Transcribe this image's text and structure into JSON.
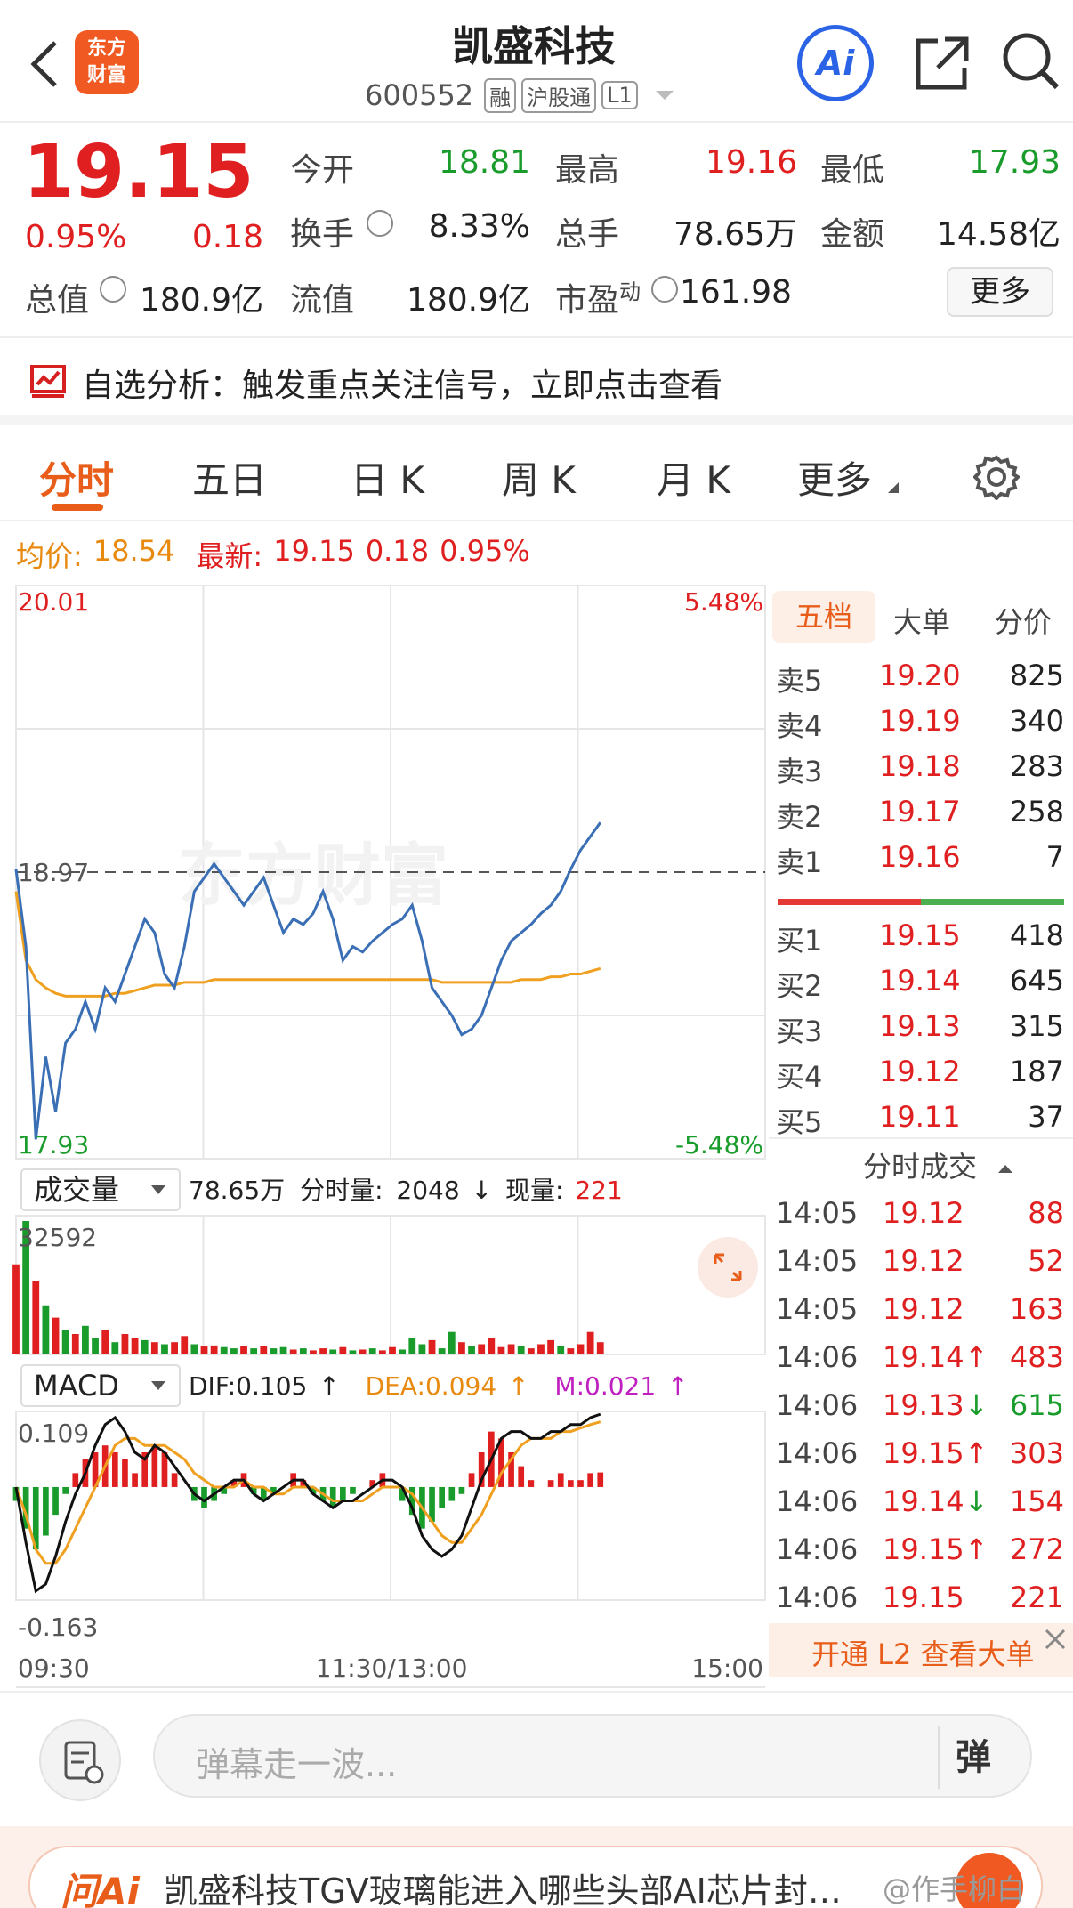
{
  "header": {
    "stock_name": "凯盛科技",
    "stock_code": "600552",
    "badges": [
      "融",
      "沪股通",
      "L1"
    ],
    "logo_text_top": "东方",
    "logo_text_bottom": "财富",
    "ai_label": "Ai"
  },
  "quote": {
    "price": "19.15",
    "change_pct": "0.95%",
    "change": "0.18",
    "rows": [
      [
        {
          "label": "今开",
          "value": "18.81",
          "color": "green"
        },
        {
          "label": "最高",
          "value": "19.16",
          "color": "red"
        },
        {
          "label": "最低",
          "value": "17.93",
          "color": "green"
        }
      ],
      [
        {
          "label": "换手",
          "value": "8.33%",
          "color": "dark"
        },
        {
          "label": "总手",
          "value": "78.65万",
          "color": "dark"
        },
        {
          "label": "金额",
          "value": "14.58亿",
          "color": "dark"
        }
      ],
      [
        {
          "label": "流值",
          "value": "180.9亿",
          "color": "dark"
        },
        {
          "label": "市盈",
          "sup": "动",
          "value": "161.98",
          "color": "dark"
        }
      ]
    ],
    "total_value_label": "总值",
    "total_value": "180.9亿",
    "more_button": "更多"
  },
  "analysis_banner": "自选分析：触发重点关注信号，立即点击查看",
  "tabs": [
    "分时",
    "五日",
    "日 K",
    "周 K",
    "月 K",
    "更多"
  ],
  "active_tab": 0,
  "summary": {
    "avg_label": "均价:",
    "avg_value": "18.54",
    "latest_label": "最新:",
    "latest_value": "19.15",
    "latest_change": "0.18",
    "latest_pct": "0.95%"
  },
  "chart_data": [
    {
      "type": "line",
      "name_price": "分时",
      "y_top_label": "20.01",
      "y_bottom_label": "17.93",
      "y_mid_label": "18.97",
      "pct_top_label": "5.48%",
      "pct_bottom_label": "-5.48%",
      "ylim": [
        17.93,
        20.01
      ],
      "prev_close": 18.97,
      "price_series": [
        18.98,
        18.7,
        18.0,
        18.3,
        18.1,
        18.35,
        18.4,
        18.5,
        18.4,
        18.55,
        18.5,
        18.6,
        18.7,
        18.8,
        18.75,
        18.6,
        18.55,
        18.7,
        18.9,
        18.95,
        19.0,
        18.95,
        18.9,
        18.85,
        18.9,
        18.95,
        18.85,
        18.75,
        18.8,
        18.78,
        18.82,
        18.9,
        18.8,
        18.65,
        18.7,
        18.68,
        18.72,
        18.75,
        18.78,
        18.8,
        18.85,
        18.72,
        18.55,
        18.5,
        18.45,
        18.38,
        18.4,
        18.45,
        18.55,
        18.65,
        18.72,
        18.75,
        18.78,
        18.82,
        18.85,
        18.9,
        18.98,
        19.05,
        19.1,
        19.15
      ],
      "avg_series": [
        18.9,
        18.65,
        18.58,
        18.55,
        18.53,
        18.52,
        18.52,
        18.52,
        18.52,
        18.52,
        18.53,
        18.53,
        18.54,
        18.55,
        18.56,
        18.56,
        18.56,
        18.57,
        18.57,
        18.57,
        18.58,
        18.58,
        18.58,
        18.58,
        18.58,
        18.58,
        18.58,
        18.58,
        18.58,
        18.58,
        18.58,
        18.58,
        18.58,
        18.58,
        18.58,
        18.58,
        18.58,
        18.58,
        18.58,
        18.58,
        18.58,
        18.58,
        18.58,
        18.57,
        18.57,
        18.57,
        18.57,
        18.57,
        18.57,
        18.57,
        18.57,
        18.58,
        18.58,
        18.58,
        18.59,
        18.59,
        18.6,
        18.6,
        18.61,
        18.62
      ],
      "x_labels": [
        "09:30",
        "11:30/13:00",
        "15:00"
      ]
    },
    {
      "type": "bar",
      "name": "成交量",
      "total": "78.65万",
      "tick_volume_label": "分时量:",
      "tick_volume": "2048",
      "now_volume_label": "现量:",
      "now_volume": "221",
      "y_max_label": "32592",
      "ylim": [
        0,
        32592
      ],
      "volumes": [
        22000,
        32592,
        18000,
        12000,
        9000,
        6000,
        5000,
        7000,
        4000,
        6000,
        3000,
        5000,
        4000,
        3500,
        3000,
        2500,
        3000,
        4500,
        2500,
        2000,
        2200,
        1800,
        1500,
        2000,
        1500,
        2000,
        1500,
        1800,
        1200,
        1500,
        1000,
        1500,
        1200,
        1800,
        1000,
        1200,
        1500,
        1000,
        1800,
        1200,
        4000,
        2500,
        3500,
        1500,
        5500,
        3000,
        2000,
        2500,
        4000,
        1800,
        2500,
        2000,
        1500,
        2500,
        3500,
        2000,
        1500,
        2500,
        5500,
        3000
      ],
      "up": [
        true,
        false,
        true,
        false,
        true,
        false,
        true,
        false,
        false,
        true,
        false,
        true,
        true,
        false,
        true,
        false,
        true,
        true,
        false,
        true,
        true,
        false,
        false,
        true,
        false,
        true,
        false,
        false,
        true,
        false,
        true,
        true,
        false,
        true,
        false,
        true,
        false,
        true,
        true,
        false,
        false,
        false,
        true,
        false,
        false,
        true,
        false,
        true,
        true,
        true,
        true,
        false,
        true,
        true,
        true,
        false,
        true,
        true,
        true,
        true
      ]
    },
    {
      "type": "bar",
      "name": "MACD",
      "dif_label": "DIF:0.105",
      "dea_label": "DEA:0.094",
      "m_label": "M:0.021",
      "y_top_label": "0.109",
      "y_bottom_label": "-0.163",
      "ylim": [
        -0.163,
        0.109
      ],
      "hist": [
        -0.02,
        -0.06,
        -0.09,
        -0.07,
        -0.04,
        -0.01,
        0.02,
        0.04,
        0.05,
        0.06,
        0.05,
        0.04,
        0.02,
        0.05,
        0.06,
        0.05,
        0.02,
        0.0,
        -0.02,
        -0.03,
        -0.02,
        -0.01,
        0.01,
        0.02,
        -0.01,
        -0.02,
        -0.01,
        0.0,
        0.02,
        0.01,
        -0.01,
        -0.02,
        -0.03,
        -0.02,
        -0.01,
        0.0,
        0.01,
        0.02,
        0.0,
        -0.02,
        -0.04,
        -0.06,
        -0.05,
        -0.03,
        -0.02,
        -0.01,
        0.02,
        0.05,
        0.08,
        0.07,
        0.05,
        0.03,
        0.01,
        0.0,
        0.01,
        0.02,
        0.01,
        0.01,
        0.02,
        0.021
      ],
      "dif": [
        0.0,
        -0.08,
        -0.15,
        -0.14,
        -0.1,
        -0.05,
        -0.01,
        0.02,
        0.06,
        0.09,
        0.1,
        0.08,
        0.05,
        0.04,
        0.06,
        0.05,
        0.03,
        0.01,
        -0.01,
        -0.02,
        -0.01,
        0.0,
        0.01,
        0.01,
        -0.01,
        -0.02,
        -0.01,
        0.0,
        0.01,
        0.01,
        -0.01,
        -0.02,
        -0.03,
        -0.02,
        -0.02,
        -0.01,
        0.0,
        0.01,
        0.01,
        0.0,
        -0.03,
        -0.07,
        -0.09,
        -0.1,
        -0.09,
        -0.07,
        -0.03,
        0.01,
        0.04,
        0.07,
        0.08,
        0.08,
        0.07,
        0.07,
        0.08,
        0.08,
        0.09,
        0.09,
        0.1,
        0.105
      ],
      "dea": [
        0.0,
        -0.04,
        -0.09,
        -0.11,
        -0.11,
        -0.09,
        -0.06,
        -0.03,
        0.0,
        0.03,
        0.06,
        0.07,
        0.07,
        0.06,
        0.06,
        0.06,
        0.05,
        0.04,
        0.02,
        0.01,
        0.0,
        0.0,
        0.0,
        0.01,
        0.0,
        0.0,
        -0.01,
        -0.01,
        0.0,
        0.0,
        0.0,
        -0.01,
        -0.02,
        -0.02,
        -0.02,
        -0.02,
        -0.01,
        0.0,
        0.0,
        0.0,
        -0.01,
        -0.03,
        -0.05,
        -0.07,
        -0.08,
        -0.08,
        -0.06,
        -0.04,
        -0.01,
        0.02,
        0.04,
        0.06,
        0.07,
        0.07,
        0.07,
        0.08,
        0.08,
        0.085,
        0.09,
        0.094
      ]
    }
  ],
  "orderbook": {
    "tabs": [
      "五档",
      "大单",
      "分价"
    ],
    "asks": [
      {
        "label": "卖5",
        "price": "19.20",
        "vol": "825"
      },
      {
        "label": "卖4",
        "price": "19.19",
        "vol": "340"
      },
      {
        "label": "卖3",
        "price": "19.18",
        "vol": "283"
      },
      {
        "label": "卖2",
        "price": "19.17",
        "vol": "258"
      },
      {
        "label": "卖1",
        "price": "19.16",
        "vol": "7"
      }
    ],
    "bids": [
      {
        "label": "买1",
        "price": "19.15",
        "vol": "418"
      },
      {
        "label": "买2",
        "price": "19.14",
        "vol": "645"
      },
      {
        "label": "买3",
        "price": "19.13",
        "vol": "315"
      },
      {
        "label": "买4",
        "price": "19.12",
        "vol": "187"
      },
      {
        "label": "买5",
        "price": "19.11",
        "vol": "37"
      }
    ],
    "ask_ratio": 0.5
  },
  "trades": {
    "title": "分时成交",
    "rows": [
      {
        "time": "14:05",
        "price": "19.12",
        "dir": "",
        "vol": "88",
        "color": "red"
      },
      {
        "time": "14:05",
        "price": "19.12",
        "dir": "",
        "vol": "52",
        "color": "red"
      },
      {
        "time": "14:05",
        "price": "19.12",
        "dir": "",
        "vol": "163",
        "color": "red"
      },
      {
        "time": "14:06",
        "price": "19.14",
        "dir": "↑",
        "vol": "483",
        "color": "red"
      },
      {
        "time": "14:06",
        "price": "19.13",
        "dir": "↓",
        "vol": "615",
        "color": "green"
      },
      {
        "time": "14:06",
        "price": "19.15",
        "dir": "↑",
        "vol": "303",
        "color": "red"
      },
      {
        "time": "14:06",
        "price": "19.14",
        "dir": "↓",
        "vol": "154",
        "color": "red"
      },
      {
        "time": "14:06",
        "price": "19.15",
        "dir": "↑",
        "vol": "272",
        "color": "red"
      },
      {
        "time": "14:06",
        "price": "19.15",
        "dir": "",
        "vol": "221",
        "color": "red"
      }
    ],
    "l2_banner": "开通 L2 查看大单"
  },
  "comment": {
    "placeholder": "弹幕走一波...",
    "danmu_button": "弹"
  },
  "news": {
    "badge": "问Ai",
    "text": "凯盛科技TGV玻璃能进入哪些头部AI芯片封…",
    "watermark": "@作手柳白"
  },
  "watermark_logo": "东方财富",
  "colors": {
    "red": "#e02020",
    "green": "#1a9c2c",
    "orange": "#e88a10",
    "price_line": "#3b6fb5",
    "avg_line": "#f0a020",
    "accent": "#e85d1a"
  }
}
